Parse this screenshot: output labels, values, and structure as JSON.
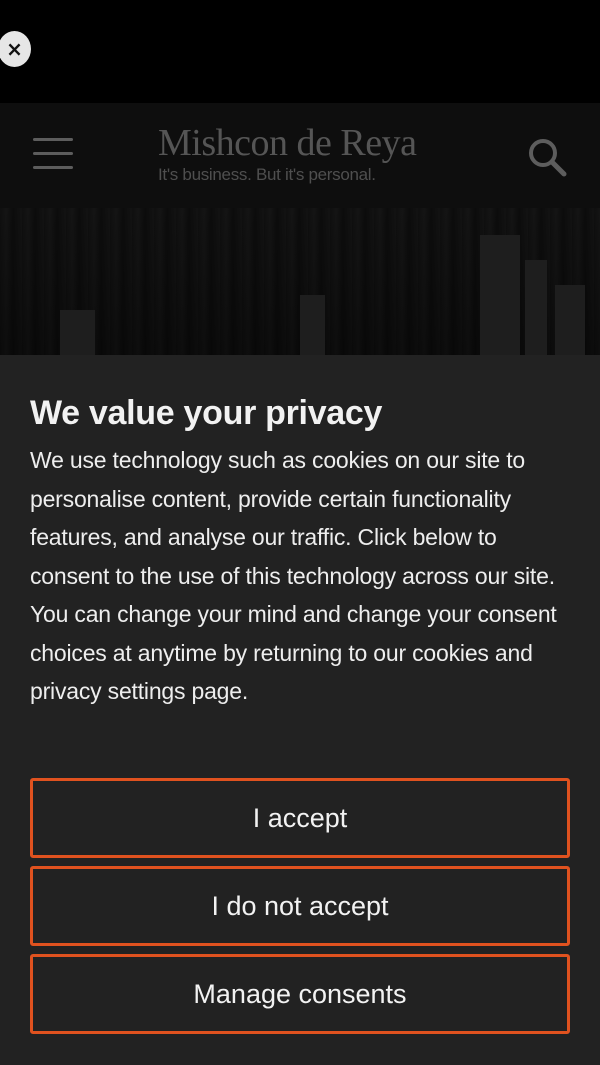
{
  "overlay": {
    "close_label": "×"
  },
  "header": {
    "menu_icon": "hamburger-menu-icon",
    "logo_name": "Mishcon de Reya",
    "logo_tagline": "It's business. But it's personal.",
    "search_icon": "search-icon"
  },
  "consent": {
    "title": "We value your privacy",
    "body": "We use technology such as cookies on our site to personalise content, provide certain functionality features, and analyse our traffic. Click below to consent to the use of this technology across our site. You can change your mind and change your consent choices at anytime by returning to our cookies and privacy settings page.",
    "accept_label": "I accept",
    "decline_label": "I do not accept",
    "manage_label": "Manage consents"
  },
  "colors": {
    "accent": "#e0521f",
    "panel_bg": "#222222",
    "header_bg": "#0e0e0e"
  }
}
